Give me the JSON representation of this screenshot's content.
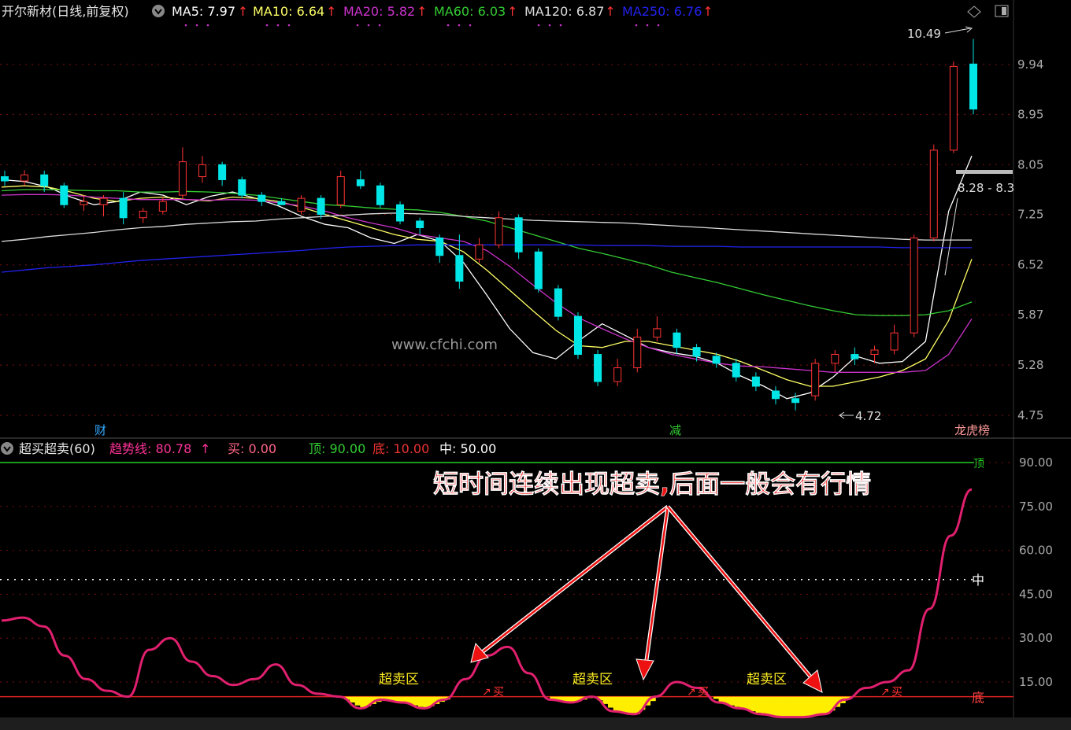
{
  "price_header": {
    "title": "开尔新材(日线,前复权)",
    "mas": [
      {
        "label": "MA5: 7.97",
        "color": "#ffffff"
      },
      {
        "label": "MA10: 6.64",
        "color": "#ffff66"
      },
      {
        "label": "MA20: 5.82",
        "color": "#cc33cc"
      },
      {
        "label": "MA60: 6.03",
        "color": "#33cc33"
      },
      {
        "label": "MA120: 6.87",
        "color": "#dddddd"
      },
      {
        "label": "MA250: 6.76",
        "color": "#2222ee"
      }
    ]
  },
  "price_axis": [
    "9.94",
    "8.95",
    "8.05",
    "7.25",
    "6.52",
    "5.87",
    "5.28",
    "4.75"
  ],
  "price_annotations": {
    "high": "10.49",
    "low": "4.72",
    "range": "8.28 - 8.3",
    "watermark": "www.cfchi.com",
    "markers": [
      {
        "text": "财",
        "color": "#33aaff"
      },
      {
        "text": "减",
        "color": "#33cc33"
      },
      {
        "text": "龙虎榜",
        "color": "#ff9999"
      }
    ]
  },
  "indicator_header": {
    "title": "超买超卖(60)",
    "trend": "趋势线: 80.78",
    "buy": "买: 0.00",
    "top": "顶: 90.00",
    "bottom": "底: 10.00",
    "mid": "中: 50.00"
  },
  "indicator_axis": [
    "90.00",
    "75.00",
    "60.00",
    "45.00",
    "30.00",
    "15.00"
  ],
  "indicator_labels": {
    "top": "顶",
    "mid": "中",
    "bottom": "底",
    "zones": [
      "超卖区",
      "超卖区",
      "超卖区"
    ],
    "buy_marks": [
      "买",
      "买",
      "买",
      "买"
    ],
    "annotation": "短时间连续出现超卖,后面一般会有行情"
  },
  "chart_data": {
    "type": "candlestick",
    "price_ylim": [
      4.5,
      10.8
    ],
    "ma_series": [
      {
        "name": "MA5",
        "color": "#ffffff",
        "values": [
          7.8,
          7.77,
          7.68,
          7.52,
          7.4,
          7.45,
          7.6,
          7.55,
          7.4,
          7.53,
          7.6,
          7.5,
          7.38,
          7.22,
          7.1,
          7.05,
          6.9,
          6.82,
          6.95,
          6.85,
          6.55,
          6.12,
          5.7,
          5.42,
          5.35,
          5.56,
          5.76,
          5.62,
          5.48,
          5.42,
          5.38,
          5.3,
          5.16,
          5.05,
          4.92,
          4.98,
          5.15,
          5.38,
          5.3,
          5.32,
          5.55,
          7.3,
          8.2
        ]
      },
      {
        "name": "MA10",
        "color": "#ffff66",
        "values": [
          7.68,
          7.7,
          7.68,
          7.6,
          7.5,
          7.45,
          7.5,
          7.52,
          7.48,
          7.46,
          7.52,
          7.5,
          7.45,
          7.36,
          7.25,
          7.15,
          7.05,
          6.95,
          6.88,
          6.85,
          6.7,
          6.45,
          6.18,
          5.92,
          5.68,
          5.5,
          5.48,
          5.55,
          5.55,
          5.5,
          5.45,
          5.4,
          5.32,
          5.22,
          5.12,
          5.05,
          5.05,
          5.1,
          5.15,
          5.22,
          5.35,
          5.8,
          6.6
        ]
      },
      {
        "name": "MA20",
        "color": "#cc33cc",
        "values": [
          7.55,
          7.56,
          7.56,
          7.55,
          7.52,
          7.5,
          7.48,
          7.48,
          7.48,
          7.47,
          7.48,
          7.47,
          7.43,
          7.38,
          7.3,
          7.2,
          7.12,
          7.05,
          6.95,
          6.9,
          6.85,
          6.72,
          6.5,
          6.25,
          6.02,
          5.83,
          5.7,
          5.58,
          5.48,
          5.4,
          5.35,
          5.3,
          5.27,
          5.26,
          5.24,
          5.22,
          5.2,
          5.2,
          5.2,
          5.2,
          5.22,
          5.4,
          5.82
        ]
      },
      {
        "name": "MA60",
        "color": "#33cc33",
        "values": [
          7.62,
          7.64,
          7.64,
          7.63,
          7.62,
          7.62,
          7.6,
          7.6,
          7.61,
          7.6,
          7.58,
          7.55,
          7.5,
          7.45,
          7.4,
          7.38,
          7.35,
          7.33,
          7.32,
          7.28,
          7.22,
          7.15,
          7.05,
          6.95,
          6.85,
          6.75,
          6.68,
          6.6,
          6.52,
          6.42,
          6.35,
          6.28,
          6.2,
          6.12,
          6.05,
          5.98,
          5.92,
          5.87,
          5.86,
          5.86,
          5.87,
          5.92,
          6.03
        ]
      },
      {
        "name": "MA120",
        "color": "#dddddd",
        "values": [
          6.85,
          6.88,
          6.92,
          6.95,
          6.98,
          7.02,
          7.05,
          7.07,
          7.1,
          7.12,
          7.14,
          7.15,
          7.18,
          7.2,
          7.22,
          7.24,
          7.26,
          7.27,
          7.26,
          7.25,
          7.22,
          7.2,
          7.18,
          7.16,
          7.15,
          7.14,
          7.13,
          7.12,
          7.1,
          7.08,
          7.06,
          7.04,
          7.02,
          7.0,
          6.98,
          6.96,
          6.94,
          6.92,
          6.9,
          6.88,
          6.87,
          6.87,
          6.87
        ]
      },
      {
        "name": "MA250",
        "color": "#2222ee",
        "values": [
          6.42,
          6.45,
          6.48,
          6.5,
          6.52,
          6.55,
          6.58,
          6.6,
          6.62,
          6.64,
          6.66,
          6.68,
          6.7,
          6.72,
          6.75,
          6.77,
          6.78,
          6.79,
          6.8,
          6.8,
          6.8,
          6.8,
          6.8,
          6.8,
          6.8,
          6.8,
          6.79,
          6.79,
          6.79,
          6.78,
          6.78,
          6.78,
          6.77,
          6.77,
          6.77,
          6.77,
          6.77,
          6.77,
          6.77,
          6.76,
          6.76,
          6.76,
          6.76
        ]
      }
    ],
    "candles": [
      {
        "o": 7.85,
        "h": 7.95,
        "l": 7.7,
        "c": 7.78
      },
      {
        "o": 7.78,
        "h": 7.96,
        "l": 7.7,
        "c": 7.88
      },
      {
        "o": 7.88,
        "h": 7.95,
        "l": 7.6,
        "c": 7.7
      },
      {
        "o": 7.7,
        "h": 7.75,
        "l": 7.35,
        "c": 7.4
      },
      {
        "o": 7.4,
        "h": 7.55,
        "l": 7.3,
        "c": 7.45
      },
      {
        "o": 7.4,
        "h": 7.55,
        "l": 7.22,
        "c": 7.5
      },
      {
        "o": 7.5,
        "h": 7.6,
        "l": 7.1,
        "c": 7.2
      },
      {
        "o": 7.2,
        "h": 7.35,
        "l": 7.12,
        "c": 7.3
      },
      {
        "o": 7.3,
        "h": 7.52,
        "l": 7.25,
        "c": 7.45
      },
      {
        "o": 7.55,
        "h": 8.35,
        "l": 7.5,
        "c": 8.1
      },
      {
        "o": 7.85,
        "h": 8.2,
        "l": 7.75,
        "c": 8.05
      },
      {
        "o": 8.05,
        "h": 8.1,
        "l": 7.7,
        "c": 7.8
      },
      {
        "o": 7.8,
        "h": 7.85,
        "l": 7.5,
        "c": 7.55
      },
      {
        "o": 7.55,
        "h": 7.6,
        "l": 7.38,
        "c": 7.45
      },
      {
        "o": 7.45,
        "h": 7.5,
        "l": 7.4,
        "c": 7.4
      },
      {
        "o": 7.3,
        "h": 7.55,
        "l": 7.25,
        "c": 7.5
      },
      {
        "o": 7.5,
        "h": 7.55,
        "l": 7.18,
        "c": 7.25
      },
      {
        "o": 7.4,
        "h": 7.95,
        "l": 7.35,
        "c": 7.85
      },
      {
        "o": 7.8,
        "h": 7.95,
        "l": 7.65,
        "c": 7.7
      },
      {
        "o": 7.7,
        "h": 7.75,
        "l": 7.35,
        "c": 7.4
      },
      {
        "o": 7.4,
        "h": 7.45,
        "l": 7.1,
        "c": 7.15
      },
      {
        "o": 7.15,
        "h": 7.2,
        "l": 6.95,
        "c": 7.05
      },
      {
        "o": 6.9,
        "h": 6.95,
        "l": 6.55,
        "c": 6.65
      },
      {
        "o": 6.65,
        "h": 6.95,
        "l": 6.2,
        "c": 6.3
      },
      {
        "o": 6.6,
        "h": 6.9,
        "l": 6.55,
        "c": 6.8
      },
      {
        "o": 6.8,
        "h": 7.3,
        "l": 6.75,
        "c": 7.2
      },
      {
        "o": 7.2,
        "h": 7.25,
        "l": 6.6,
        "c": 6.7
      },
      {
        "o": 6.7,
        "h": 6.75,
        "l": 6.15,
        "c": 6.2
      },
      {
        "o": 6.2,
        "h": 6.25,
        "l": 5.8,
        "c": 5.85
      },
      {
        "o": 5.85,
        "h": 5.9,
        "l": 5.35,
        "c": 5.4
      },
      {
        "o": 5.4,
        "h": 5.45,
        "l": 5.05,
        "c": 5.1
      },
      {
        "o": 5.1,
        "h": 5.35,
        "l": 5.05,
        "c": 5.25
      },
      {
        "o": 5.25,
        "h": 5.7,
        "l": 5.2,
        "c": 5.6
      },
      {
        "o": 5.6,
        "h": 5.85,
        "l": 5.55,
        "c": 5.7
      },
      {
        "o": 5.65,
        "h": 5.7,
        "l": 5.4,
        "c": 5.48
      },
      {
        "o": 5.48,
        "h": 5.52,
        "l": 5.32,
        "c": 5.38
      },
      {
        "o": 5.38,
        "h": 5.42,
        "l": 5.25,
        "c": 5.3
      },
      {
        "o": 5.3,
        "h": 5.35,
        "l": 5.1,
        "c": 5.15
      },
      {
        "o": 5.15,
        "h": 5.2,
        "l": 5.0,
        "c": 5.05
      },
      {
        "o": 5.0,
        "h": 5.05,
        "l": 4.86,
        "c": 4.92
      },
      {
        "o": 4.92,
        "h": 4.98,
        "l": 4.8,
        "c": 4.88
      },
      {
        "o": 4.95,
        "h": 5.35,
        "l": 4.9,
        "c": 5.3
      },
      {
        "o": 5.3,
        "h": 5.45,
        "l": 5.2,
        "c": 5.4
      },
      {
        "o": 5.4,
        "h": 5.48,
        "l": 5.28,
        "c": 5.35
      },
      {
        "o": 5.4,
        "h": 5.5,
        "l": 5.3,
        "c": 5.45
      },
      {
        "o": 5.45,
        "h": 5.75,
        "l": 5.4,
        "c": 5.65
      },
      {
        "o": 5.65,
        "h": 6.95,
        "l": 5.6,
        "c": 6.9
      },
      {
        "o": 6.9,
        "h": 8.4,
        "l": 6.85,
        "c": 8.3
      },
      {
        "o": 8.3,
        "h": 10.0,
        "l": 8.25,
        "c": 9.9
      },
      {
        "o": 9.95,
        "h": 10.49,
        "l": 8.95,
        "c": 9.05
      }
    ],
    "indicator_ylim": [
      0,
      100
    ],
    "trend_line": [
      36,
      37,
      34,
      24,
      16,
      12,
      10,
      26,
      30,
      22,
      17,
      14,
      16,
      21,
      14,
      11,
      10,
      6,
      9,
      8,
      6,
      9,
      16,
      24,
      27,
      18,
      9,
      8,
      10,
      5,
      4,
      10,
      15,
      13,
      8,
      6,
      4,
      3,
      3,
      4,
      9,
      13,
      15,
      19,
      40,
      65,
      80.78
    ],
    "trend_line_x": [
      0,
      20,
      40,
      60,
      80,
      100,
      120,
      140,
      160,
      180,
      200,
      220,
      240,
      260,
      280,
      300,
      320,
      340,
      360,
      380,
      400,
      420,
      440,
      460,
      480,
      500,
      520,
      540,
      560,
      580,
      600,
      620,
      640,
      660,
      680,
      700,
      720,
      740,
      760,
      780,
      800,
      820,
      840,
      860,
      880,
      900,
      920
    ],
    "top_level": 90.0,
    "bottom_level": 10.0,
    "mid_level": 50.0
  }
}
